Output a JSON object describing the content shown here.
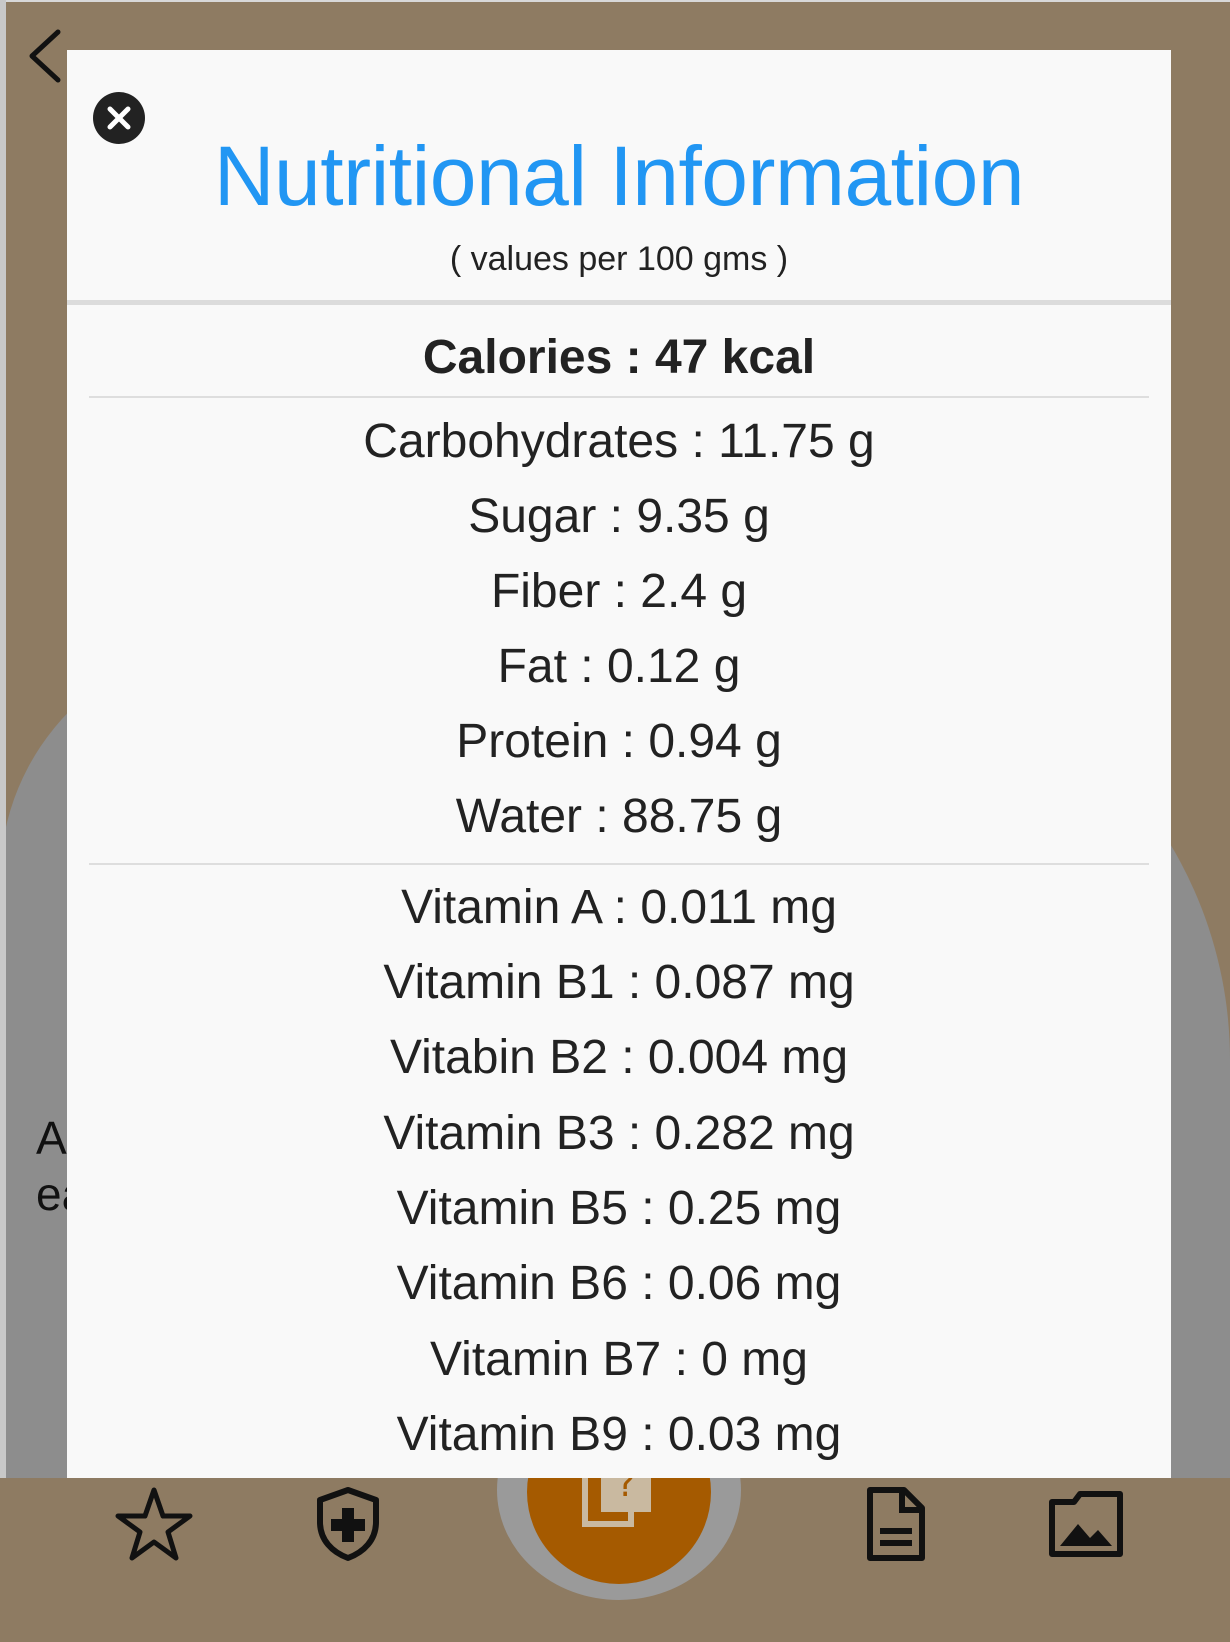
{
  "background": {
    "text_lines": [
      "A",
      "ea"
    ]
  },
  "modal": {
    "title": "Nutritional Information",
    "subtitle": "( values per 100 gms )",
    "calories": "Calories : 47 kcal",
    "macros": [
      "Carbohydrates : 11.75 g",
      "Sugar : 9.35 g",
      "Fiber : 2.4 g",
      "Fat : 0.12 g",
      "Protein : 0.94 g",
      "Water : 88.75 g"
    ],
    "vitamins": [
      "Vitamin A : 0.011 mg",
      "Vitamin B1 : 0.087 mg",
      "Vitabin B2 : 0.004 mg",
      "Vitamin B3 : 0.282 mg",
      "Vitamin B5 : 0.25 mg",
      "Vitamin B6 : 0.06 mg",
      "Vitamin B7 : 0 mg",
      "Vitamin B9 : 0.03 mg"
    ]
  },
  "icons": {
    "back": "chevron-left-icon",
    "close": "close-icon",
    "nav": [
      "star-icon",
      "shield-plus-icon",
      "quiz-card-icon",
      "document-icon",
      "photo-icon"
    ]
  },
  "colors": {
    "title": "#2196f3",
    "fab": "#a55a00",
    "bar": "#8e7b62"
  }
}
